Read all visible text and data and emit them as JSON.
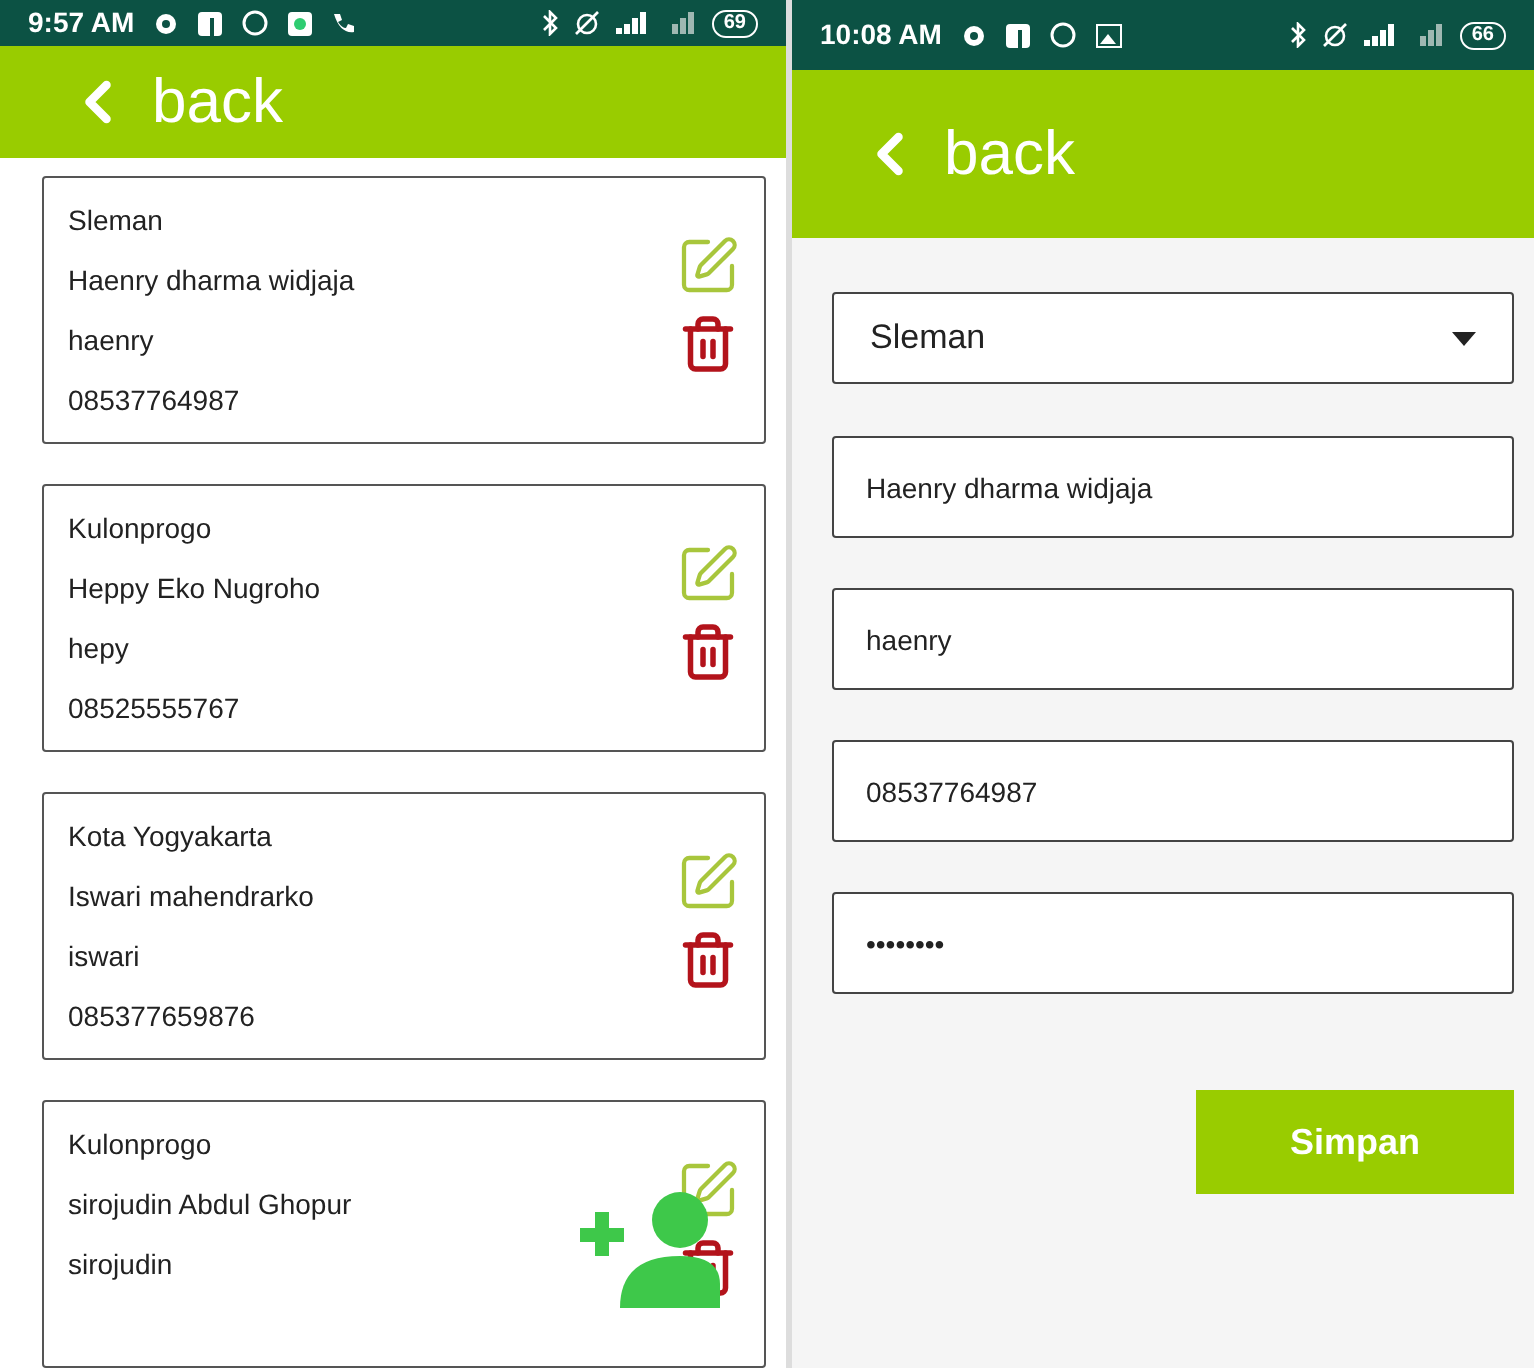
{
  "list_screen": {
    "status_bar": {
      "time": "9:57 AM",
      "battery": "69"
    },
    "app_bar": {
      "back_label": "back"
    },
    "contacts": [
      {
        "region": "Sleman",
        "name": "Haenry dharma widjaja",
        "username": "haenry",
        "phone": "08537764987"
      },
      {
        "region": "Kulonprogo",
        "name": "Heppy Eko Nugroho",
        "username": "hepy",
        "phone": "08525555767"
      },
      {
        "region": "Kota Yogyakarta",
        "name": "Iswari mahendrarko",
        "username": "iswari",
        "phone": "085377659876"
      },
      {
        "region": "Kulonprogo",
        "name": "sirojudin Abdul Ghopur",
        "username": "sirojudin"
      }
    ]
  },
  "form_screen": {
    "status_bar": {
      "time": "10:08 AM",
      "battery": "66"
    },
    "app_bar": {
      "back_label": "back"
    },
    "region_dropdown": "Sleman",
    "fields": [
      {
        "value": "Haenry dharma widjaja"
      },
      {
        "value": "haenry"
      },
      {
        "value": "08537764987"
      },
      {
        "value": "••••••••"
      }
    ],
    "save_button": "Simpan"
  }
}
